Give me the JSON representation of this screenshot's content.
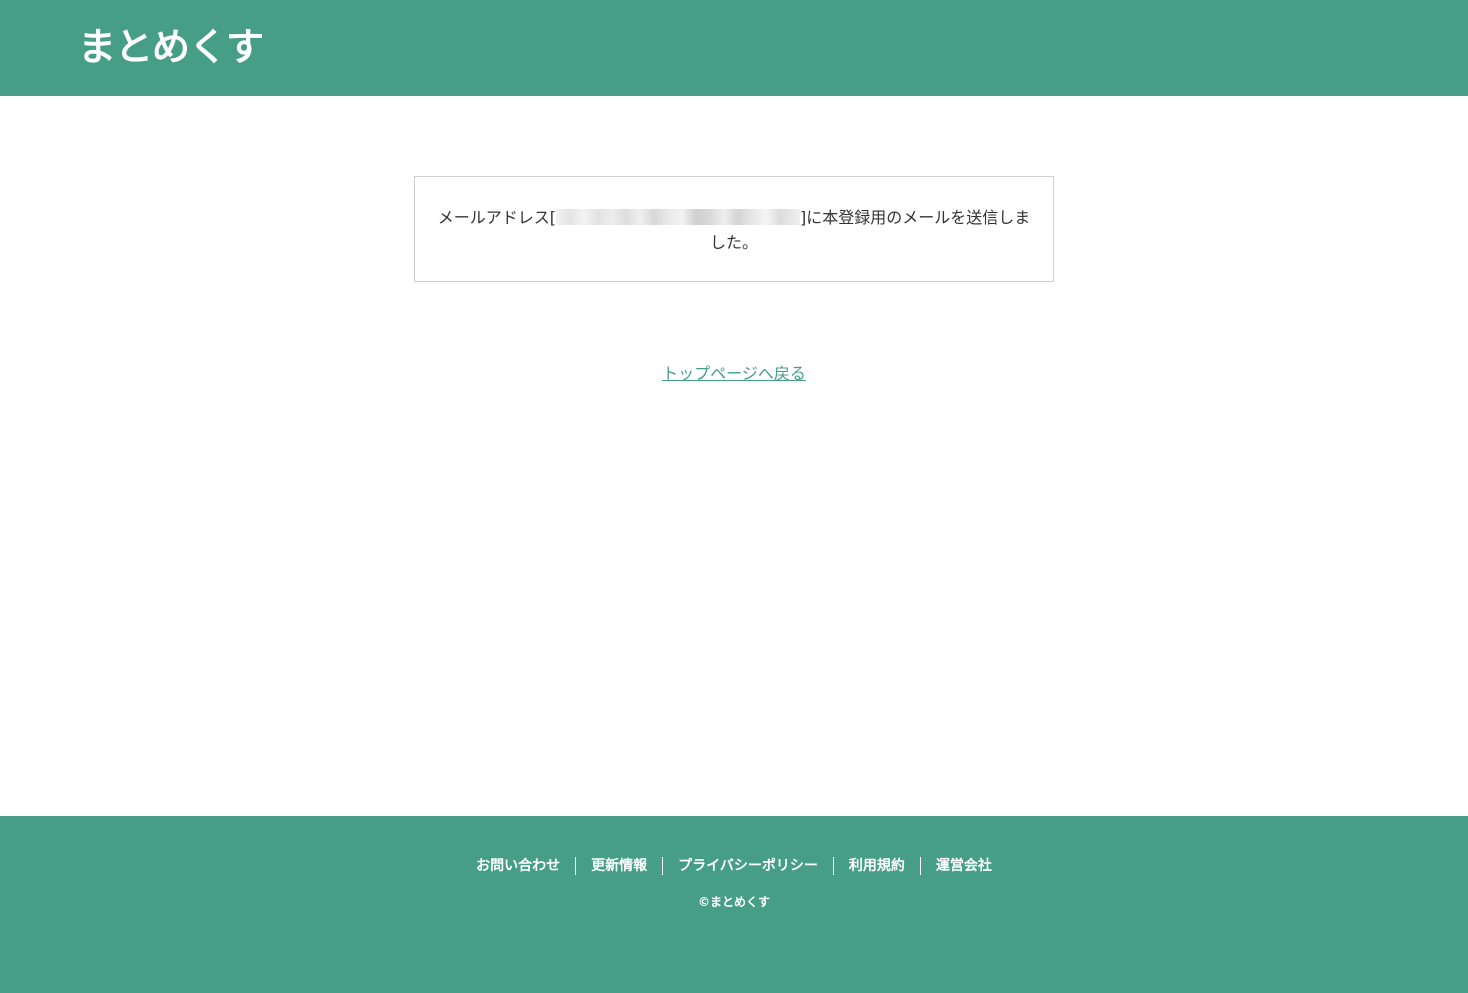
{
  "header": {
    "logo": "まとめくす",
    "background_color": "#469e87"
  },
  "message": {
    "prefix": "メールアドレス[",
    "suffix": "]に本登録用のメールを送信しました。"
  },
  "back_link": {
    "label": "トップページへ戻る"
  },
  "footer": {
    "nav": [
      {
        "label": "お問い合わせ"
      },
      {
        "label": "更新情報"
      },
      {
        "label": "プライバシーポリシー"
      },
      {
        "label": "利用規約"
      },
      {
        "label": "運営会社"
      }
    ],
    "copyright": "©まとめくす"
  },
  "colors": {
    "brand": "#469e87",
    "text": "#333333",
    "border": "#cfcfcf"
  }
}
